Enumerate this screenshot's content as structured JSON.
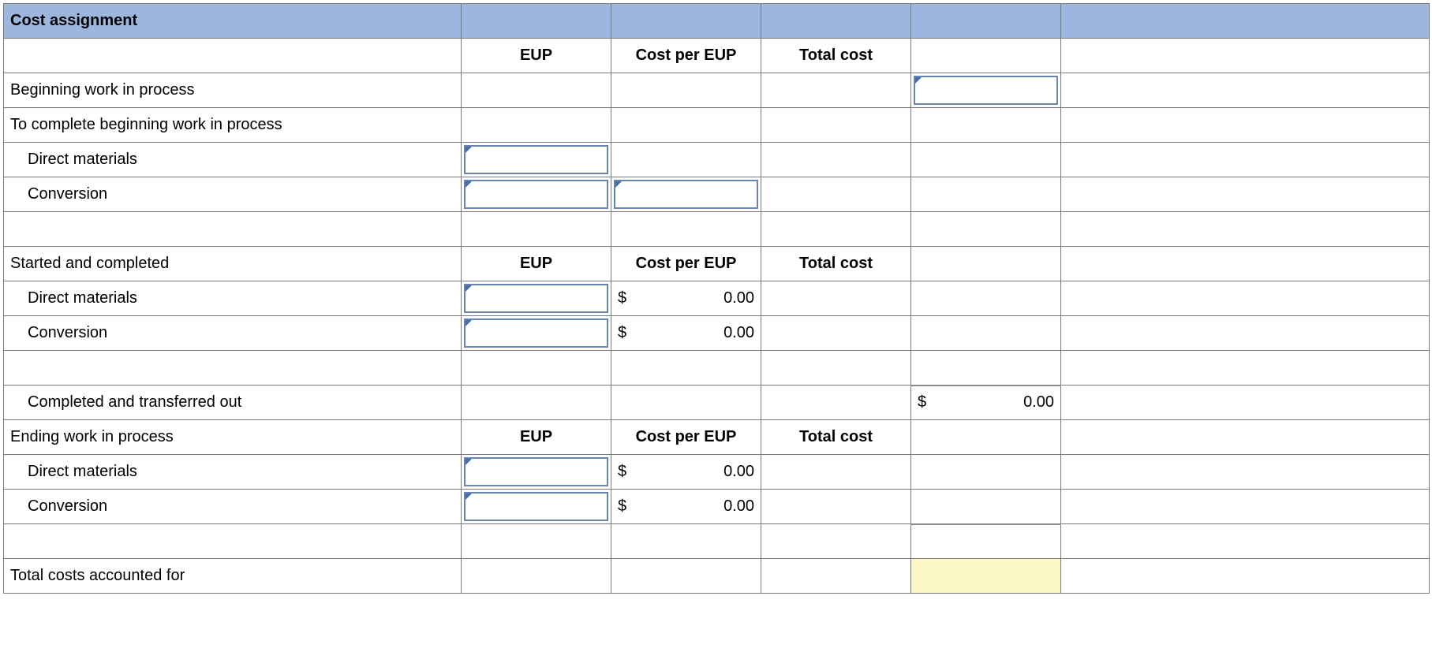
{
  "header": {
    "title": "Cost assignment"
  },
  "cols": {
    "eup": "EUP",
    "cost_per_eup": "Cost per EUP",
    "total_cost": "Total cost"
  },
  "rows": {
    "bwip": "Beginning work in process",
    "to_complete_bwip": "To complete beginning work in process",
    "dm": "Direct materials",
    "conv": "Conversion",
    "started_completed": "Started and completed",
    "completed_transferred": "Completed and transferred out",
    "ewip": "Ending work in process",
    "total_accounted": "Total costs accounted for"
  },
  "money": {
    "sym": "$",
    "zero": "0.00"
  }
}
